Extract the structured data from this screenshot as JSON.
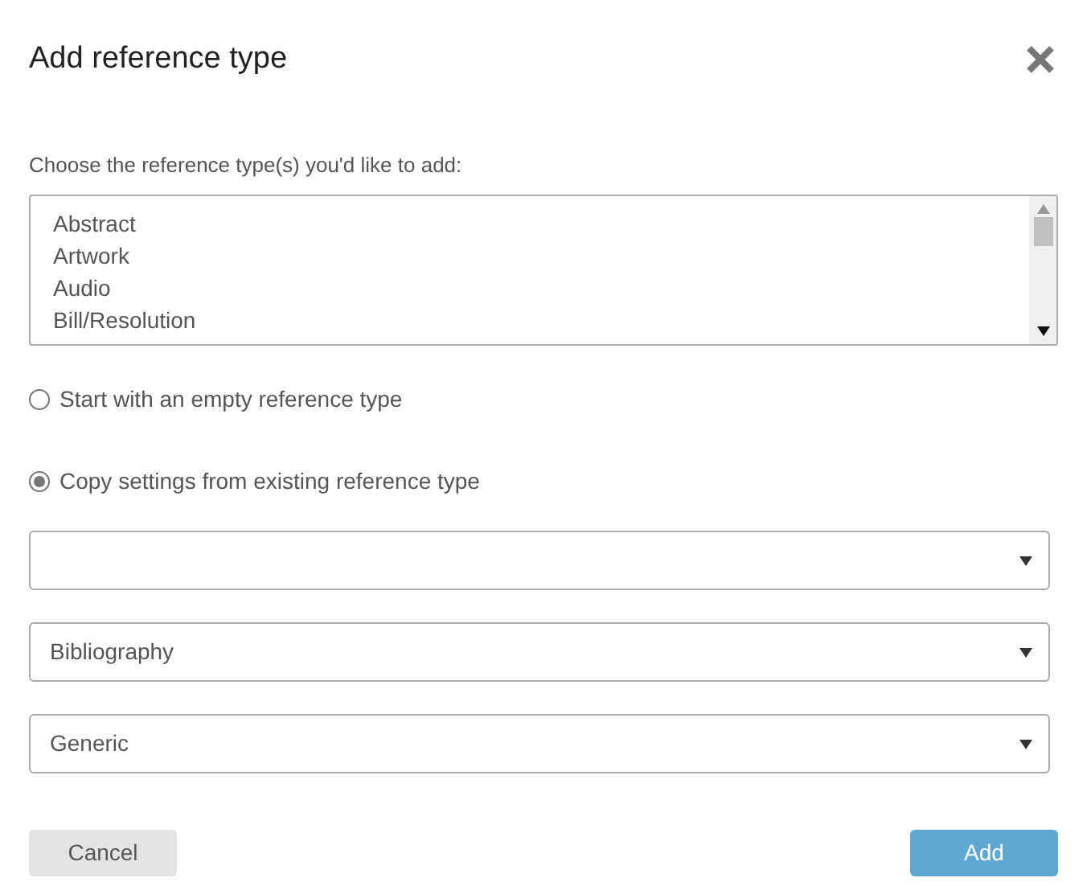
{
  "dialog": {
    "title": "Add reference type"
  },
  "prompt": "Choose the reference type(s) you'd like to add:",
  "reference_types": [
    {
      "label": "Abstract",
      "selected": false
    },
    {
      "label": "Artwork",
      "selected": false
    },
    {
      "label": "Audio",
      "selected": false
    },
    {
      "label": "Bill/Resolution",
      "selected": false
    }
  ],
  "options": [
    {
      "label": "Start with an empty reference type",
      "selected": false
    },
    {
      "label": "Copy settings from existing reference type",
      "selected": true
    }
  ],
  "dropdowns": [
    "Bibliography",
    "Generic"
  ],
  "buttons": [
    {
      "label": "Cancel",
      "kind": "secondary"
    },
    {
      "label": "Add",
      "kind": "primary"
    }
  ]
}
